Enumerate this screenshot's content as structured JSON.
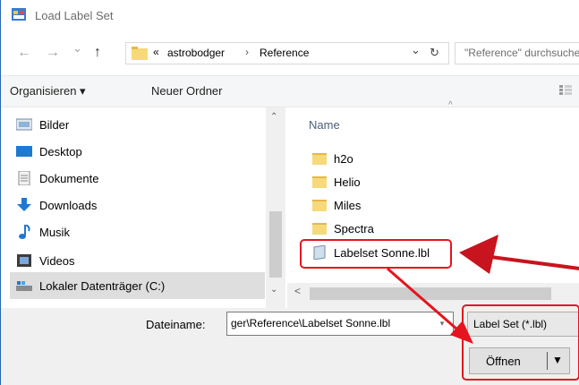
{
  "window": {
    "title": "Load Label Set"
  },
  "nav": {
    "back_glyph": "←",
    "forward_glyph": "→",
    "recent_glyph": "⌄",
    "up_glyph": "↑",
    "breadcrumb_prefix": "«",
    "breadcrumb": [
      "astrobodger",
      "Reference"
    ],
    "breadcrumb_sep": "›",
    "dropdown_glyph": "⌄",
    "refresh_glyph": "↻",
    "search_placeholder": "\"Reference\" durchsuchen"
  },
  "toolbar": {
    "organize_label": "Organisieren ▾",
    "new_folder_label": "Neuer Ordner"
  },
  "sidebar": {
    "items": [
      {
        "label": "Bilder",
        "icon": "pictures-icon"
      },
      {
        "label": "Desktop",
        "icon": "desktop-icon"
      },
      {
        "label": "Dokumente",
        "icon": "documents-icon"
      },
      {
        "label": "Downloads",
        "icon": "downloads-icon"
      },
      {
        "label": "Musik",
        "icon": "music-icon"
      },
      {
        "label": "Videos",
        "icon": "videos-icon"
      },
      {
        "label": "Lokaler Datenträger (C:)",
        "icon": "drive-icon"
      }
    ]
  },
  "file_list": {
    "column_header": "Name",
    "items": [
      {
        "name": "h2o",
        "type": "folder"
      },
      {
        "name": "Helio",
        "type": "folder"
      },
      {
        "name": "Miles",
        "type": "folder"
      },
      {
        "name": "Spectra",
        "type": "folder"
      },
      {
        "name": "Labelset Sonne.lbl",
        "type": "file"
      }
    ]
  },
  "bottom": {
    "filename_label": "Dateiname:",
    "filename_value": "ger\\Reference\\Labelset Sonne.lbl",
    "filter_value": "Label Set (*.lbl)",
    "open_label": "Öffnen"
  },
  "colors": {
    "highlight": "#e6141e",
    "folder": "#f7d97a",
    "selection": "#dedede"
  }
}
